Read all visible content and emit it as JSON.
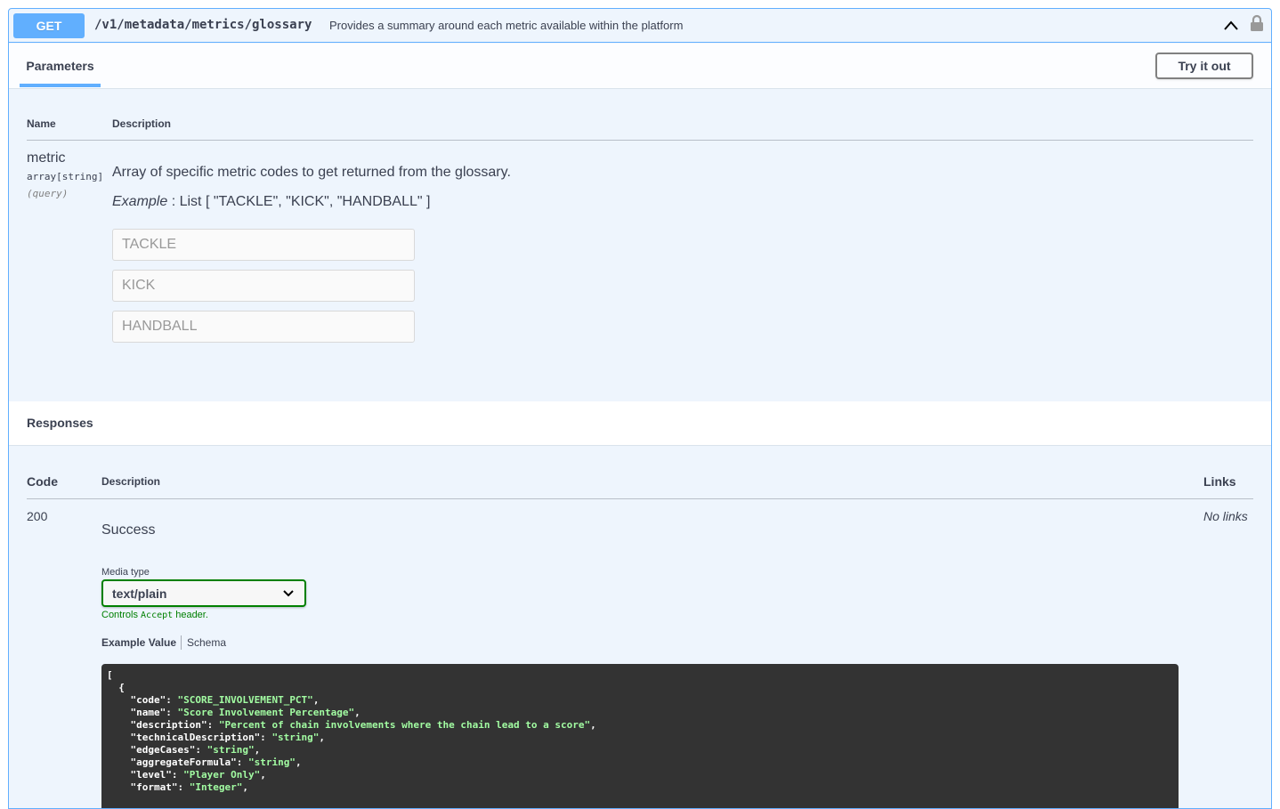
{
  "summary": {
    "method": "GET",
    "path": "/v1/metadata/metrics/glossary",
    "description": "Provides a summary around each metric available within the platform"
  },
  "params_section": {
    "tab_label": "Parameters",
    "try_button": "Try it out",
    "col_name": "Name",
    "col_description": "Description"
  },
  "parameter": {
    "name": "metric",
    "type": "array[string]",
    "in": "(query)",
    "description": "Array of specific metric codes to get returned from the glossary.",
    "example_label": "Example",
    "example_value": ": List [ \"TACKLE\", \"KICK\", \"HANDBALL\" ]",
    "inputs": [
      "TACKLE",
      "KICK",
      "HANDBALL"
    ]
  },
  "responses": {
    "title": "Responses",
    "col_code": "Code",
    "col_description": "Description",
    "col_links": "Links",
    "rows": [
      {
        "code": "200",
        "description": "Success",
        "links": "No links"
      }
    ],
    "media_type_label": "Media type",
    "media_type_value": "text/plain",
    "controls_prefix": "Controls ",
    "controls_code": "Accept",
    "controls_suffix": " header.",
    "example_tab": "Example Value",
    "schema_tab": "Schema",
    "example_lines": [
      [
        "[",
        null
      ],
      [
        "  {",
        null
      ],
      [
        "    \"code\": ",
        "\"SCORE_INVOLVEMENT_PCT\"",
        ","
      ],
      [
        "    \"name\": ",
        "\"Score Involvement Percentage\"",
        ","
      ],
      [
        "    \"description\": ",
        "\"Percent of chain involvements where the chain lead to a score\"",
        ","
      ],
      [
        "    \"technicalDescription\": ",
        "\"string\"",
        ","
      ],
      [
        "    \"edgeCases\": ",
        "\"string\"",
        ","
      ],
      [
        "    \"aggregateFormula\": ",
        "\"string\"",
        ","
      ],
      [
        "    \"level\": ",
        "\"Player Only\"",
        ","
      ],
      [
        "    \"format\": ",
        "\"Integer\"",
        ","
      ]
    ]
  },
  "colors": {
    "accent": "#61affe",
    "panel_bg": "#eef5fd",
    "success_green": "#008000",
    "code_bg": "#333333",
    "code_string": "#a2fca2"
  },
  "icons": [
    "chevron-up-icon",
    "lock-icon",
    "chevron-down-icon"
  ]
}
